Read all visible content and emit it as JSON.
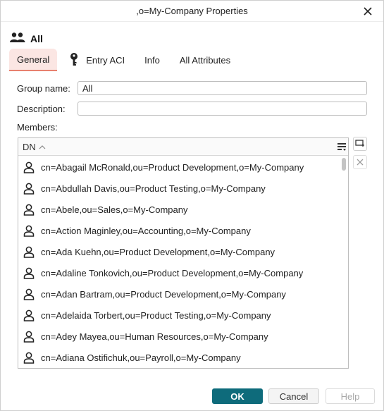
{
  "window": {
    "title": ",o=My-Company Properties"
  },
  "header": {
    "name": "All",
    "icon": "group-icon"
  },
  "tabs": [
    {
      "label": "General",
      "active": true
    },
    {
      "label": "Entry ACI",
      "icon": "key-icon"
    },
    {
      "label": "Info"
    },
    {
      "label": "All Attributes"
    }
  ],
  "form": {
    "group_name_label": "Group name:",
    "group_name_value": "All",
    "description_label": "Description:",
    "description_value": "",
    "members_label": "Members:"
  },
  "members_table": {
    "column_header": "DN",
    "sort": "ascending",
    "rows": [
      "cn=Abagail McRonald,ou=Product Development,o=My-Company",
      "cn=Abdullah Davis,ou=Product Testing,o=My-Company",
      "cn=Abele,ou=Sales,o=My-Company",
      "cn=Action Maginley,ou=Accounting,o=My-Company",
      "cn=Ada Kuehn,ou=Product Development,o=My-Company",
      "cn=Adaline Tonkovich,ou=Product Development,o=My-Company",
      "cn=Adan Bartram,ou=Product Development,o=My-Company",
      "cn=Adelaida Torbert,ou=Product Testing,o=My-Company",
      "cn=Adey Mayea,ou=Human Resources,o=My-Company",
      "cn=Adiana Ostifichuk,ou=Payroll,o=My-Company"
    ]
  },
  "buttons": {
    "ok": "OK",
    "cancel": "Cancel",
    "help": "Help"
  },
  "colors": {
    "primary": "#0e6b7b",
    "tab_active_bg": "#fbe6e3",
    "tab_active_underline": "#e8806e"
  }
}
